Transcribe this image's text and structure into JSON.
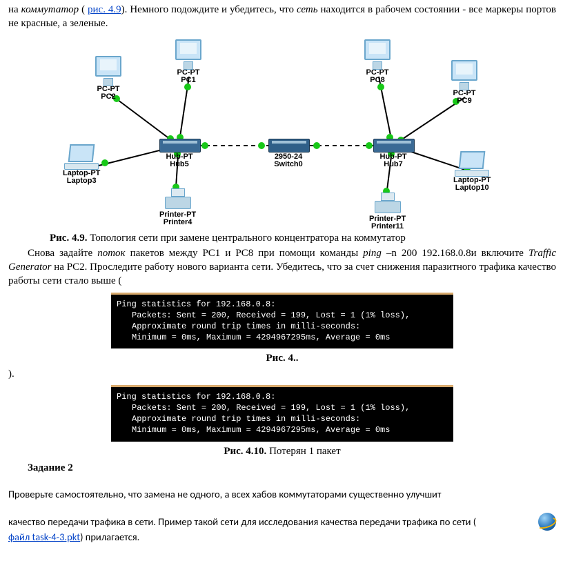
{
  "intro": {
    "pre1": "на ",
    "kommutator": "коммутатор",
    "pre2": " ( ",
    "link": "рис. 4.9",
    "post": "). Немного подождите и убедитесь, что ",
    "set": "сеть",
    "post2": " находится в рабочем состоянии - все маркеры портов не красные, а зеленые."
  },
  "diagram": {
    "devices": {
      "pc1": {
        "l1": "PC-PT",
        "l2": "PC1"
      },
      "pc2": {
        "l1": "PC-PT",
        "l2": "PC2"
      },
      "laptop3": {
        "l1": "Laptop-PT",
        "l2": "Laptop3"
      },
      "printer4": {
        "l1": "Printer-PT",
        "l2": "Printer4"
      },
      "hub5": {
        "l1": "Hub-PT",
        "l2": "Hub5"
      },
      "switch0": {
        "l1": "2950-24",
        "l2": "Switch0"
      },
      "hub7": {
        "l1": "Hub-PT",
        "l2": "Hub7"
      },
      "pc8": {
        "l1": "PC-PT",
        "l2": "PC8"
      },
      "pc9": {
        "l1": "PC-PT",
        "l2": "PC9"
      },
      "laptop10": {
        "l1": "Laptop-PT",
        "l2": "Laptop10"
      },
      "printer11": {
        "l1": "Printer-PT",
        "l2": "Printer11"
      }
    }
  },
  "caption_49": {
    "bold": "Рис. 4.9.",
    "rest": " Топология сети при замене центрального концентратора на коммутатор"
  },
  "para2": {
    "p1": "Снова задайте ",
    "potok": "поток",
    "p2": " пакетов между PC1 и PC8 при помощи команды ",
    "ping": "ping",
    "p3": " –n 200 192.168.0.8и включите ",
    "tg": "Traffic Generator",
    "p4": " на PC2. Проследите работу нового варианта сети. Убедитесь, что за счет снижения паразитного трафика качество работы сети стало выше ("
  },
  "ping": {
    "l1": "Ping statistics for 192.168.0.8:",
    "l2": "Packets: Sent = 200, Received = 199, Lost = 1 (1% loss),",
    "l3": "Approximate round trip times in milli-seconds:",
    "l4": "Minimum = 0ms, Maximum = 4294967295ms, Average = 0ms"
  },
  "caption_4x": {
    "bold": "Рис. 4.."
  },
  "close_paren": ").",
  "caption_410": {
    "bold": "Рис. 4.10.",
    "rest": " Потерян 1 пакет"
  },
  "task2": {
    "heading": "Задание 2",
    "p_a": "Проверьте самостоятельно, что замена не одного, а всех хабов коммутаторами существенно улучшит",
    "p_b_pre": "качество передачи трафика в сети. Пример такой сети для исследования качества передачи трафика по сети ( ",
    "file_link": "файл task-4-3.pkt",
    "p_b_post": ") прилагается."
  }
}
